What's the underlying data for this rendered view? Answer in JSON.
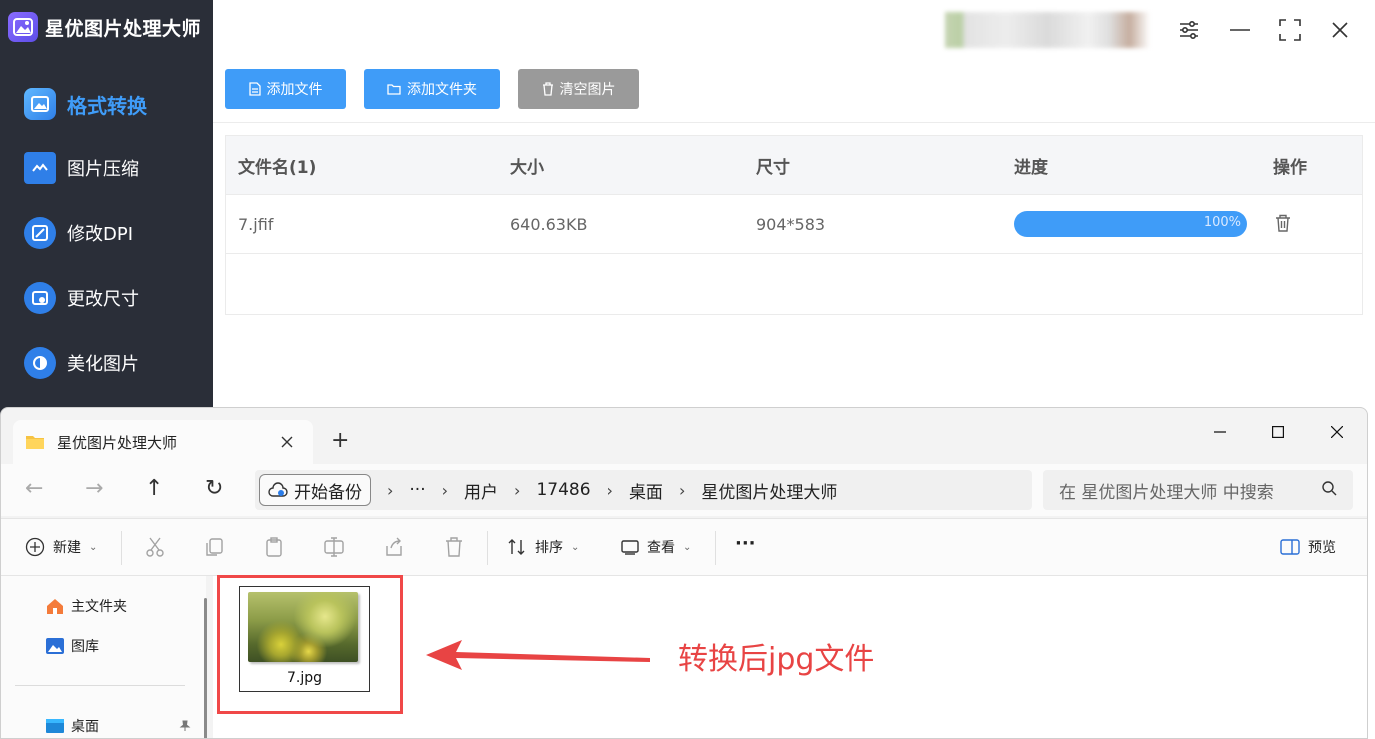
{
  "app": {
    "title": "星优图片处理大师",
    "accent": "#3f9cf8",
    "sidebar": {
      "items": [
        {
          "label": "格式转换",
          "icon": "image-convert-icon",
          "active": true
        },
        {
          "label": "图片压缩",
          "icon": "compress-icon"
        },
        {
          "label": "修改DPI",
          "icon": "dpi-icon"
        },
        {
          "label": "更改尺寸",
          "icon": "resize-icon"
        },
        {
          "label": "美化图片",
          "icon": "beautify-icon"
        }
      ]
    },
    "toolbar": {
      "add_file": "添加文件",
      "add_folder": "添加文件夹",
      "clear": "清空图片"
    },
    "table": {
      "headers": [
        "文件名(1)",
        "大小",
        "尺寸",
        "进度",
        "操作"
      ],
      "rows": [
        {
          "name": "7.jfif",
          "size": "640.63KB",
          "dimensions": "904*583",
          "progress": "100%",
          "progress_value": 1.0
        }
      ]
    }
  },
  "explorer": {
    "tab_title": "星优图片处理大师",
    "backup_label": "开始备份",
    "breadcrumbs": [
      "用户",
      "17486",
      "桌面",
      "星优图片处理大师"
    ],
    "ellipsis": "···",
    "search_placeholder": "在 星优图片处理大师 中搜索",
    "commands": {
      "new": "新建",
      "sort": "排序",
      "view": "查看",
      "more": "···",
      "preview": "预览"
    },
    "nav_pane": [
      {
        "label": "主文件夹",
        "icon": "home-icon"
      },
      {
        "label": "图库",
        "icon": "gallery-icon"
      },
      {
        "label": "桌面",
        "icon": "desktop-icon"
      }
    ],
    "files": [
      {
        "name": "7.jpg"
      }
    ]
  },
  "annotation": {
    "text": "转换后jpg文件",
    "color": "#e84444"
  }
}
